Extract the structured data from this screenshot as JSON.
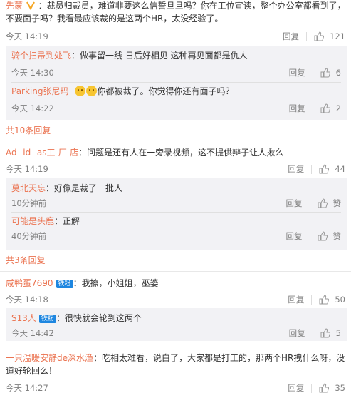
{
  "common": {
    "reply": "回复",
    "like_zan": "赞"
  },
  "comments": [
    {
      "user": "先蒙",
      "text_line1": "：裁员归裁员，难道非要这么信誓旦旦吗？你在工位宣读，整个办公室都看到了，员工",
      "text_line2": "不要面子吗？我看最应该裁的是这两个HR，太没经验了。",
      "time": "今天 14:19",
      "likes": "121",
      "replies": [
        {
          "user": "骑个扫帚到处飞",
          "text": "：做事留一线 日后好相见 这种再见面都是仇人",
          "time": "今天 14:30",
          "likes": "6"
        },
        {
          "user": "Parking张尼玛",
          "text": "你都被裁了。你觉得你还有面子吗？",
          "time": "今天 14:22",
          "likes": "2"
        }
      ],
      "more": "共10条回复"
    },
    {
      "user": "Ad--id--as工-厂-店",
      "text": "：问题是还有人在一旁录视频，这不提供辩子让人揪么",
      "time": "今天 14:19",
      "likes": "44",
      "replies": [
        {
          "user": "莫北天忘",
          "text": "：好像是裁了一批人",
          "time": "10分钟前"
        },
        {
          "user": "可能是头鹿",
          "text": "：正解",
          "time": "40分钟前"
        }
      ],
      "more": "共3条回复"
    },
    {
      "user": "咸鸭蛋7690",
      "badge": "铁粉",
      "text": "：我擦，小姐姐，巫婆",
      "time": "今天 14:18",
      "likes": "50",
      "replies": [
        {
          "user": "S13人",
          "badge": "铁粉",
          "text": "：很快就会轮到这两个",
          "time": "今天 14:42",
          "likes": "5"
        }
      ]
    },
    {
      "user": "一只温暖安静de深水渔",
      "text_line1": "：吃相太难看，说白了，大家都是打工的，那两个HR拽什么呀，没听过天",
      "text_line2": "道好轮回么！",
      "time": "今天 14:27",
      "likes": "35"
    }
  ]
}
